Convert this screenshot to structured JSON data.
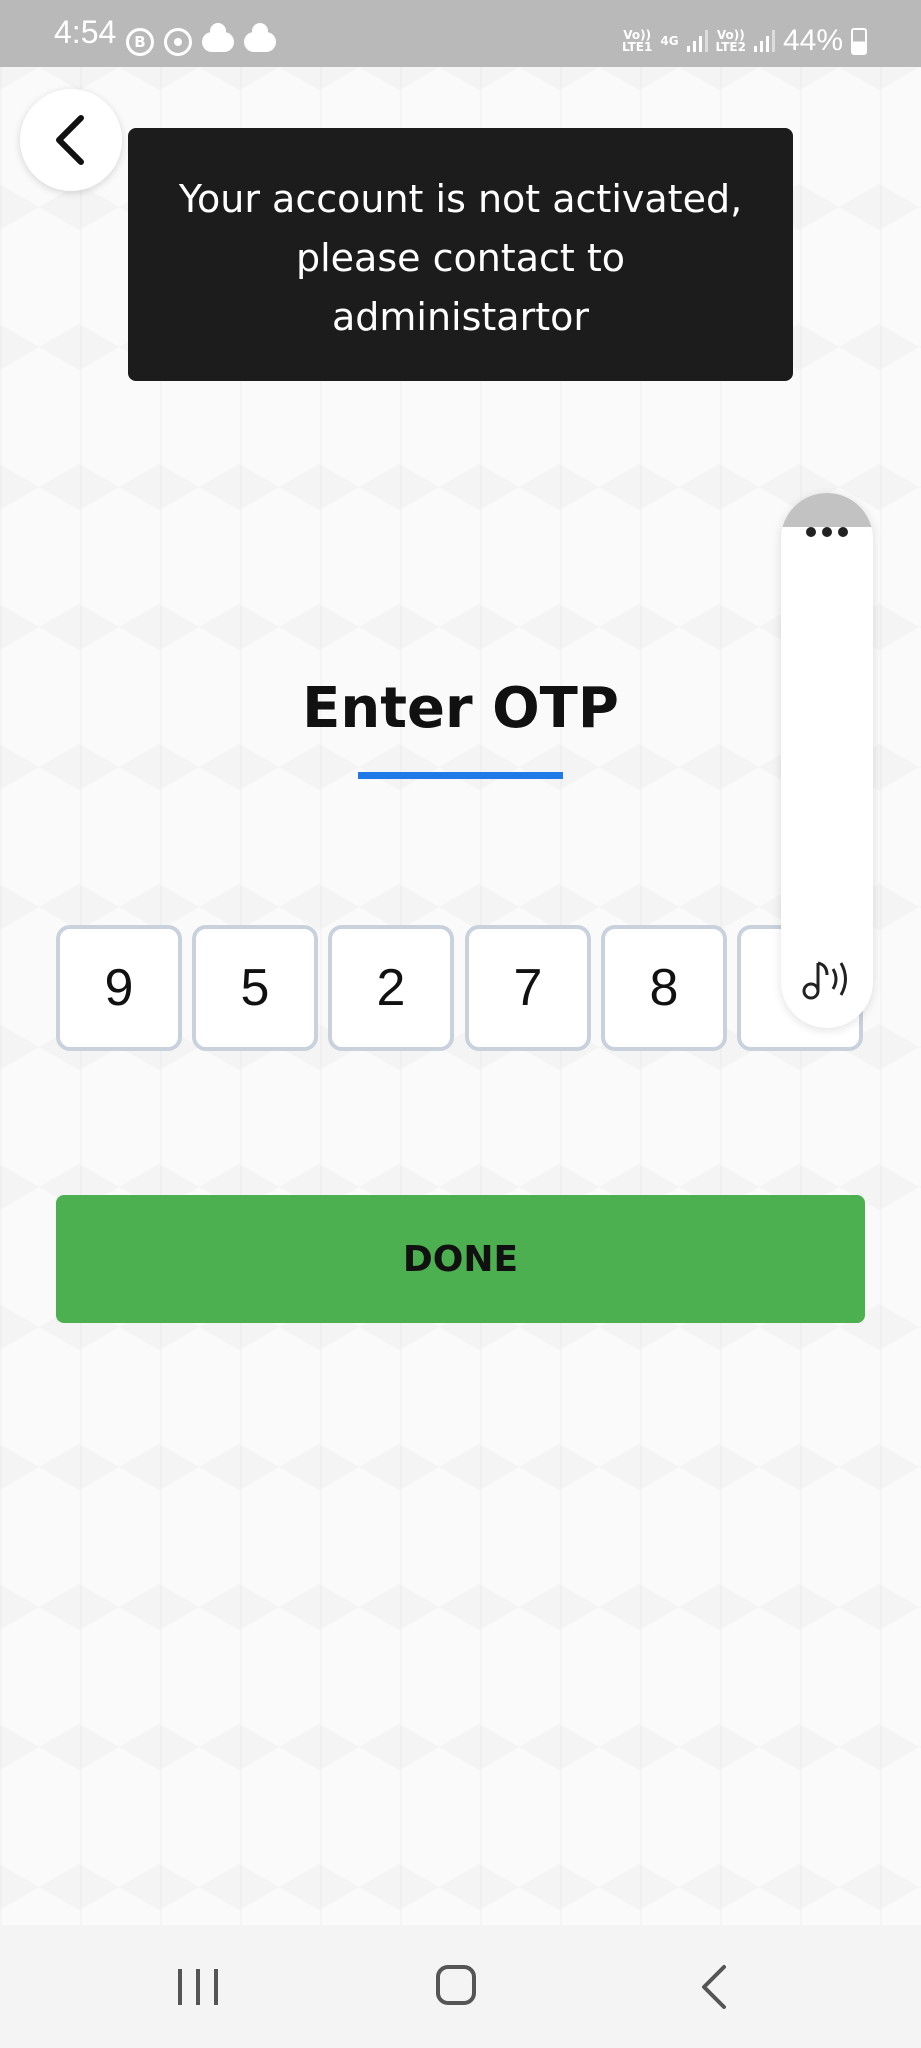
{
  "status_bar": {
    "time": "4:54",
    "notif_icon_b": "B",
    "net1": "Vo)) LTE1",
    "net1_type": "4G",
    "net2": "Vo)) LTE2",
    "battery": "44%"
  },
  "toast": {
    "message": "Your account is not activated, please contact to administartor"
  },
  "page": {
    "title": "Enter OTP",
    "accent_color": "#1f7ae8"
  },
  "otp": {
    "digits": [
      "9",
      "5",
      "2",
      "7",
      "8",
      ""
    ]
  },
  "actions": {
    "done_label": "DONE",
    "done_color": "#4caf50"
  },
  "icons": {
    "back": "chevron-left-icon",
    "more": "more-horizontal-icon",
    "music": "music-note-sound-icon",
    "nav_recents": "recents-icon",
    "nav_home": "home-icon",
    "nav_back": "back-icon"
  }
}
